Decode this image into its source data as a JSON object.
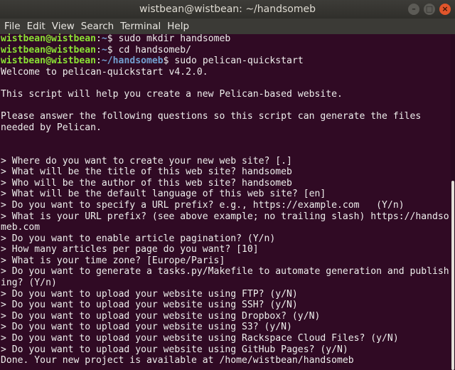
{
  "window": {
    "title": "wistbean@wistbean: ~/handsomeb",
    "controls": {
      "minimize": "–",
      "maximize": "□",
      "close": "×"
    }
  },
  "menu": [
    "File",
    "Edit",
    "View",
    "Search",
    "Terminal",
    "Help"
  ],
  "terminal": {
    "prompts": [
      {
        "user": "wistbean@wistbean",
        "sep": ":",
        "path": "~",
        "symbol": "$",
        "command": " sudo mkdir handsomeb"
      },
      {
        "user": "wistbean@wistbean",
        "sep": ":",
        "path": "~",
        "symbol": "$",
        "command": " cd handsomeb/"
      },
      {
        "user": "wistbean@wistbean",
        "sep": ":",
        "path": "~/handsomeb",
        "symbol": "$",
        "command": " sudo pelican-quickstart"
      }
    ],
    "output": [
      "Welcome to pelican-quickstart v4.2.0.",
      "",
      "This script will help you create a new Pelican-based website.",
      "",
      "Please answer the following questions so this script can generate the files",
      "needed by Pelican.",
      "",
      "",
      "> Where do you want to create your new web site? [.]",
      "> What will be the title of this web site? handsomeb",
      "> Who will be the author of this web site? handsomeb",
      "> What will be the default language of this web site? [en]",
      "> Do you want to specify a URL prefix? e.g., https://example.com   (Y/n)",
      "> What is your URL prefix? (see above example; no trailing slash) https://handso",
      "meb.com",
      "> Do you want to enable article pagination? (Y/n)",
      "> How many articles per page do you want? [10]",
      "> What is your time zone? [Europe/Paris]",
      "> Do you want to generate a tasks.py/Makefile to automate generation and publish",
      "ing? (Y/n)",
      "> Do you want to upload your website using FTP? (y/N)",
      "> Do you want to upload your website using SSH? (y/N)",
      "> Do you want to upload your website using Dropbox? (y/N)",
      "> Do you want to upload your website using S3? (y/N)",
      "> Do you want to upload your website using Rackspace Cloud Files? (y/N)",
      "> Do you want to upload your website using GitHub Pages? (y/N)",
      "Done. Your new project is available at /home/wistbean/handsomeb"
    ]
  },
  "colors": {
    "background": "#300a24",
    "user": "#8ae234",
    "path": "#729fcf",
    "text": "#eeeeec"
  }
}
